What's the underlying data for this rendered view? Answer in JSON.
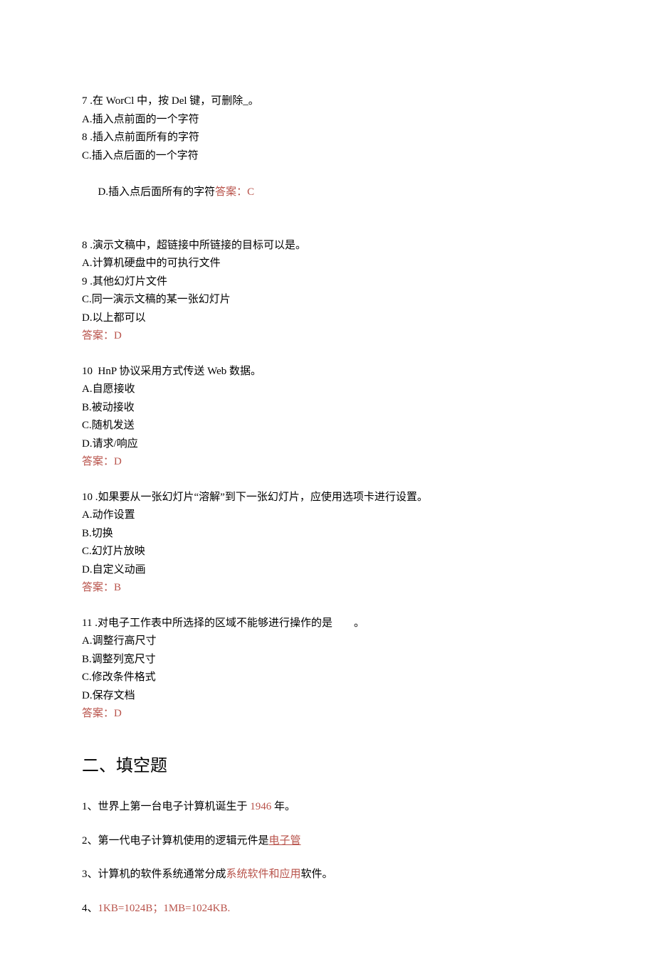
{
  "q7": {
    "stem": "7 .在 WorCl 中，按 Del 键，可删除_。",
    "optA": "A.插入点前面的一个字符",
    "optB": "8 .插入点前面所有的字符",
    "optC": "C.插入点后面的一个字符",
    "optD_prefix": "D.插入点后面所有的字符",
    "answer": "答案：C"
  },
  "q8": {
    "stem": "8 .演示文稿中，超链接中所链接的目标可以是。",
    "optA": "A.计算机硬盘中的可执行文件",
    "optB": "9 .其他幻灯片文件",
    "optC": "C.同一演示文稿的某一张幻灯片",
    "optD": "D.以上都可以",
    "answer": "答案：D"
  },
  "q9": {
    "stem": "10  HnP 协议采用方式传送 Web 数据。",
    "optA": "A.自愿接收",
    "optB": "B.被动接收",
    "optC": "C.随机发送",
    "optD": "D.请求/响应",
    "answer": "答案：D"
  },
  "q10": {
    "stem": "10 .如果要从一张幻灯片“溶解”到下一张幻灯片，应使用选项卡进行设置。",
    "optA": "A.动作设置",
    "optB": "B.切换",
    "optC": "C.幻灯片放映",
    "optD": "D.自定义动画",
    "answer": "答案：B"
  },
  "q11": {
    "stem": "11 .对电子工作表中所选择的区域不能够进行操作的是        。",
    "optA": "A.调整行高尺寸",
    "optB": "B.调整列宽尺寸",
    "optC": "C.修改条件格式",
    "optD": "D.保存文档",
    "answer": "答案：D"
  },
  "section2_title": "二、填空题",
  "fill1": {
    "prefix": "1、世界上第一台电子计算机诞生于 ",
    "ans": "1946",
    "suffix": " 年。"
  },
  "fill2": {
    "prefix": "2、第一代电子计算机使用的逻辑元件是",
    "ans": "电子管"
  },
  "fill3": {
    "prefix": "3、计算机的软件系统通常分成",
    "ans": "系统软件和应用",
    "suffix": "软件。"
  },
  "fill4": {
    "prefix": "4、",
    "ans": "1KB=1024B；1MB=1024KB."
  }
}
